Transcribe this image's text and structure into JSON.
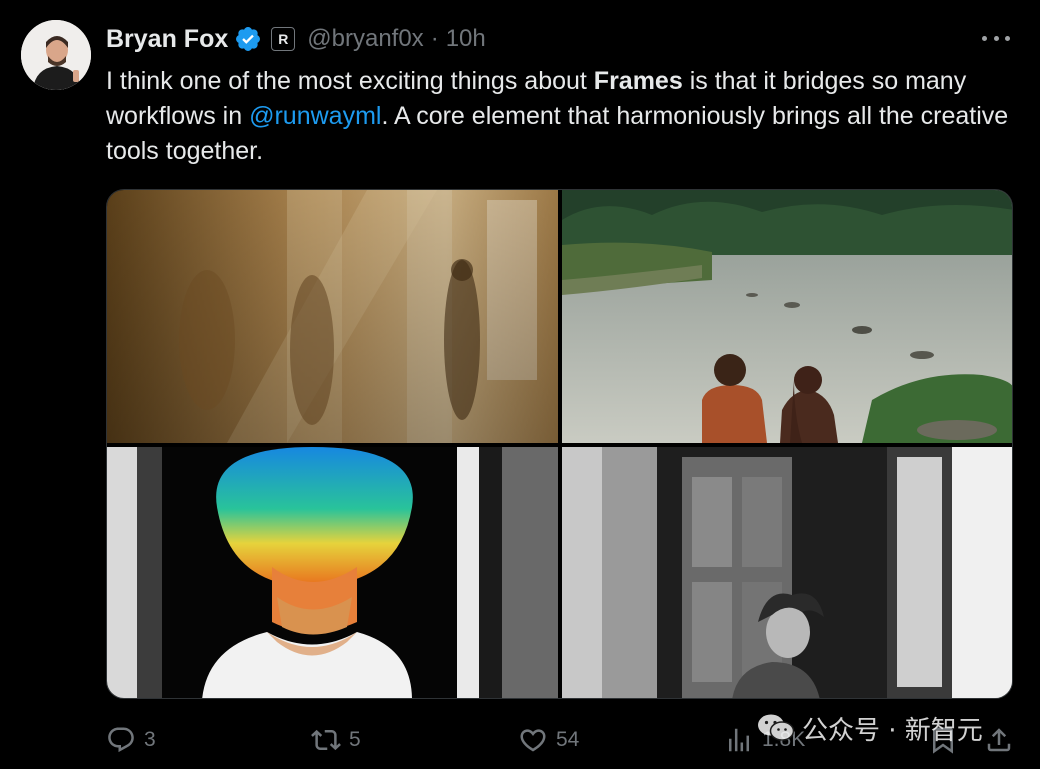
{
  "author": {
    "name": "Bryan Fox",
    "handle": "@bryanf0x",
    "separator": "·",
    "time": "10h",
    "affiliation_badge": "R",
    "verified": true
  },
  "tweet": {
    "text_before": "I think one of the most exciting things about ",
    "bold_word": "Frames",
    "text_middle": " is that it bridges so many workflows in ",
    "mention": "@runwayml",
    "text_after": ". A core element that harmoniously brings all the creative tools together."
  },
  "media": {
    "images": [
      {
        "icon": "photo-sunlit-hallway-figures"
      },
      {
        "icon": "photo-river-two-children"
      },
      {
        "icon": "photo-rainbow-light-portrait"
      },
      {
        "icon": "photo-boy-in-doorway-bw"
      }
    ]
  },
  "actions": {
    "replies": "3",
    "reposts": "5",
    "likes": "54",
    "views": "1.8K"
  },
  "watermark": {
    "text": "公众号 · 新智元"
  },
  "colors": {
    "background": "#000000",
    "text": "#e7e9ea",
    "muted": "#71767b",
    "accent": "#1d9bf0"
  }
}
